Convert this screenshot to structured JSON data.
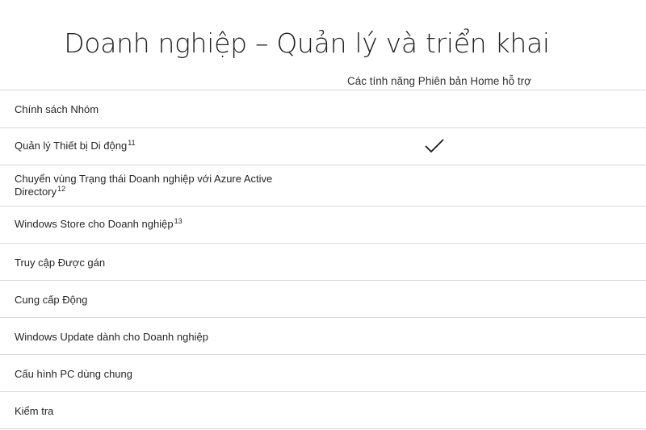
{
  "page": {
    "title": "Doanh nghiệp – Quản lý và triển khai",
    "column_header": "Các tính năng Phiên bản Home hỗ trợ"
  },
  "rows": [
    {
      "label": "Chính sách Nhóm",
      "footnote": "",
      "home_supported": false
    },
    {
      "label": "Quản lý Thiết bị Di động",
      "footnote": "11",
      "home_supported": true
    },
    {
      "label": "Chuyển vùng Trạng thái Doanh nghiệp với Azure Active Directory",
      "footnote": "12",
      "home_supported": false
    },
    {
      "label": "Windows Store cho Doanh nghiệp",
      "footnote": "13",
      "home_supported": false
    },
    {
      "label": "Truy cập Được gán",
      "footnote": "",
      "home_supported": false
    },
    {
      "label": "Cung cấp Động",
      "footnote": "",
      "home_supported": false
    },
    {
      "label": "Windows Update dành cho Doanh nghiệp",
      "footnote": "",
      "home_supported": false
    },
    {
      "label": "Cấu hình PC dùng chung",
      "footnote": "",
      "home_supported": false
    },
    {
      "label": "Kiểm tra",
      "footnote": "",
      "home_supported": false
    }
  ],
  "icons": {
    "supported": "checkmark-icon"
  }
}
